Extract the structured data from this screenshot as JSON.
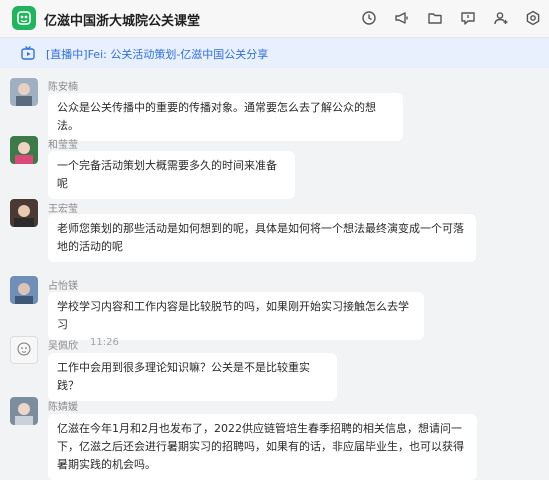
{
  "header": {
    "title": "亿滋中国浙大城院公关课堂",
    "icons": [
      "history-icon",
      "megaphone-icon",
      "folder-icon",
      "chat-bubble-icon",
      "add-user-icon",
      "settings-icon"
    ]
  },
  "banner": {
    "text": "[直播中]Fei: 公关活动策划-亿滋中国公关分享"
  },
  "messages": [
    {
      "sender": "陈安楠",
      "time": "",
      "text": "公众是公关传播中的重要的传播对象。通常要怎么去了解公众的想法。"
    },
    {
      "sender": "和莹莹",
      "time": "",
      "text": "一个完备活动策划大概需要多久的时间来准备呢"
    },
    {
      "sender": "王宏莹",
      "time": "",
      "text": "老师您策划的那些活动是如何想到的呢，具体是如何将一个想法最终演变成一个可落地的活动的呢"
    },
    {
      "sender": "占怡镁",
      "time": "",
      "text": "学校学习内容和工作内容是比较脱节的吗，如果刚开始实习接触怎么去学习"
    },
    {
      "sender": "吴佩欣",
      "time": "11:26",
      "text": "工作中会用到很多理论知识嘛？公关是不是比较重实践？"
    },
    {
      "sender": "陈婧媛",
      "time": "",
      "text": "亿滋在今年1月和2月也发布了，2022供应链管培生春季招聘的相关信息，想请问一下，亿滋之后还会进行暑期实习的招聘吗，如果有的话，非应届毕业生，也可以获得暑期实践的机会吗。"
    }
  ],
  "colors": {
    "accent_green": "#22b35e",
    "banner_bg": "#e8f0fd",
    "banner_text": "#2f6fe0"
  }
}
